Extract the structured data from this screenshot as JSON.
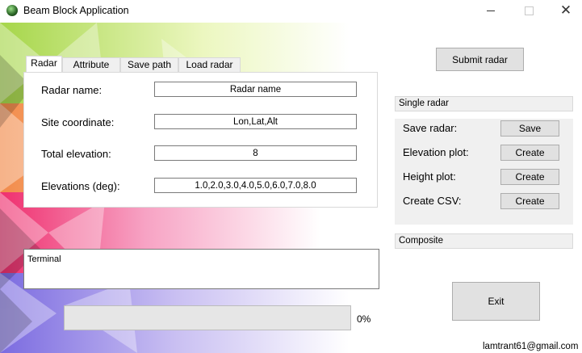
{
  "window": {
    "title": "Beam Block Application",
    "controls": {
      "minimize": "minimize-icon",
      "maximize": "maximize-icon",
      "close": "close-icon"
    }
  },
  "tabs": [
    {
      "label": "Radar",
      "active": true
    },
    {
      "label": "Attribute",
      "active": false
    },
    {
      "label": "Save path",
      "active": false
    },
    {
      "label": "Load radar",
      "active": false
    }
  ],
  "radar_form": {
    "name_label": "Radar name:",
    "name_value": "Radar name",
    "site_label": "Site coordinate:",
    "site_value": "Lon,Lat,Alt",
    "total_label": "Total elevation:",
    "total_value": "8",
    "elev_label": "Elevations (deg):",
    "elev_value": "1.0,2.0,3.0,4.0,5.0,6.0,7.0,8.0"
  },
  "submit_label": "Submit radar",
  "single_radar": {
    "header": "Single radar",
    "rows": [
      {
        "label": "Save radar:",
        "button": "Save"
      },
      {
        "label": "Elevation plot:",
        "button": "Create"
      },
      {
        "label": "Height plot:",
        "button": "Create"
      },
      {
        "label": "Create CSV:",
        "button": "Create"
      }
    ]
  },
  "composite": {
    "header": "Composite"
  },
  "terminal": {
    "label": "Terminal"
  },
  "progress": {
    "value": 0,
    "text": "0%"
  },
  "exit_label": "Exit",
  "footer": {
    "email": "lamtrant61@gmail.com"
  }
}
